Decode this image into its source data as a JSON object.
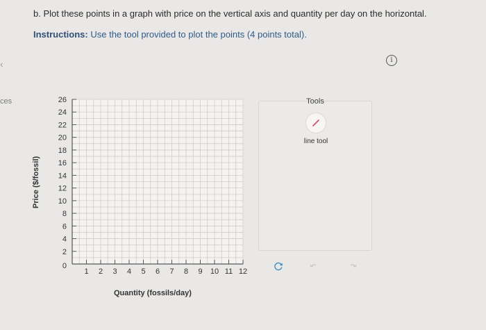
{
  "question": "b. Plot these points in a graph with price on the vertical axis and quantity per day on the horizontal.",
  "instructions": {
    "bold": "Instructions:",
    "text": " Use the tool provided to plot the points (4 points total)."
  },
  "left_edge": {
    "chevron": "‹",
    "text": "ces"
  },
  "info_icon": "i",
  "chart_data": {
    "type": "scatter",
    "xlabel": "Quantity (fossils/day)",
    "ylabel": "Price ($/fossil)",
    "xlim": [
      0,
      12
    ],
    "ylim": [
      0,
      26
    ],
    "x_ticks": [
      "1",
      "2",
      "3",
      "4",
      "5",
      "6",
      "7",
      "8",
      "9",
      "10",
      "11",
      "12"
    ],
    "y_ticks": [
      "2",
      "4",
      "6",
      "8",
      "10",
      "12",
      "14",
      "16",
      "18",
      "20",
      "22",
      "24",
      "26"
    ],
    "origin_label": "0",
    "grid": true,
    "points": []
  },
  "tools": {
    "title": "Tools",
    "line_tool_label": "line tool",
    "line_tool_icon": "line-tool-icon",
    "accent": "#d0455e"
  },
  "bottom_tools": {
    "undo_icon": "undo-icon",
    "redo_icon": "redo-icon",
    "reset_icon": "reset-icon"
  }
}
